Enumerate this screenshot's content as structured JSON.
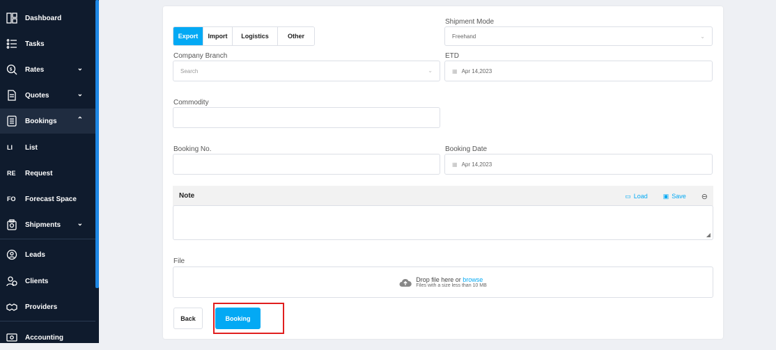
{
  "sidebar": {
    "items": [
      {
        "label": "Dashboard",
        "icon": "dashboard-icon"
      },
      {
        "label": "Tasks",
        "icon": "tasks-icon"
      },
      {
        "label": "Rates",
        "icon": "rates-icon",
        "chevron": "⌄"
      },
      {
        "label": "Quotes",
        "icon": "quotes-icon",
        "chevron": "⌄"
      },
      {
        "label": "Bookings",
        "icon": "bookings-icon",
        "chevron": "⌃"
      },
      {
        "label": "List",
        "abbr": "LI"
      },
      {
        "label": "Request",
        "abbr": "RE"
      },
      {
        "label": "Forecast Space",
        "abbr": "FO"
      },
      {
        "label": "Shipments",
        "icon": "shipments-icon",
        "chevron": "⌄"
      },
      {
        "label": "Leads",
        "icon": "leads-icon"
      },
      {
        "label": "Clients",
        "icon": "clients-icon"
      },
      {
        "label": "Providers",
        "icon": "providers-icon"
      },
      {
        "label": "Accounting",
        "icon": "accounting-icon"
      }
    ]
  },
  "tabs": [
    "Export",
    "Import",
    "Logistics",
    "Other"
  ],
  "form": {
    "shipment_mode": {
      "label": "Shipment Mode",
      "value": "Freehand"
    },
    "company_branch": {
      "label": "Company Branch",
      "placeholder": "Search"
    },
    "etd": {
      "label": "ETD",
      "value": "Apr 14,2023"
    },
    "commodity": {
      "label": "Commodity",
      "value": ""
    },
    "booking_no": {
      "label": "Booking No.",
      "value": ""
    },
    "booking_date": {
      "label": "Booking Date",
      "value": "Apr 14,2023"
    },
    "note": {
      "label": "Note",
      "load_label": "Load",
      "save_label": "Save"
    },
    "file": {
      "label": "File",
      "drop_text": "Drop file here or ",
      "browse_text": "browse",
      "limit_text": "Files with a size less than 10 MB"
    }
  },
  "buttons": {
    "back": "Back",
    "booking": "Booking"
  },
  "colors": {
    "accent": "#03a9f4",
    "sidebar_bg": "#0f1b2d",
    "highlight": "#e01e1e"
  }
}
